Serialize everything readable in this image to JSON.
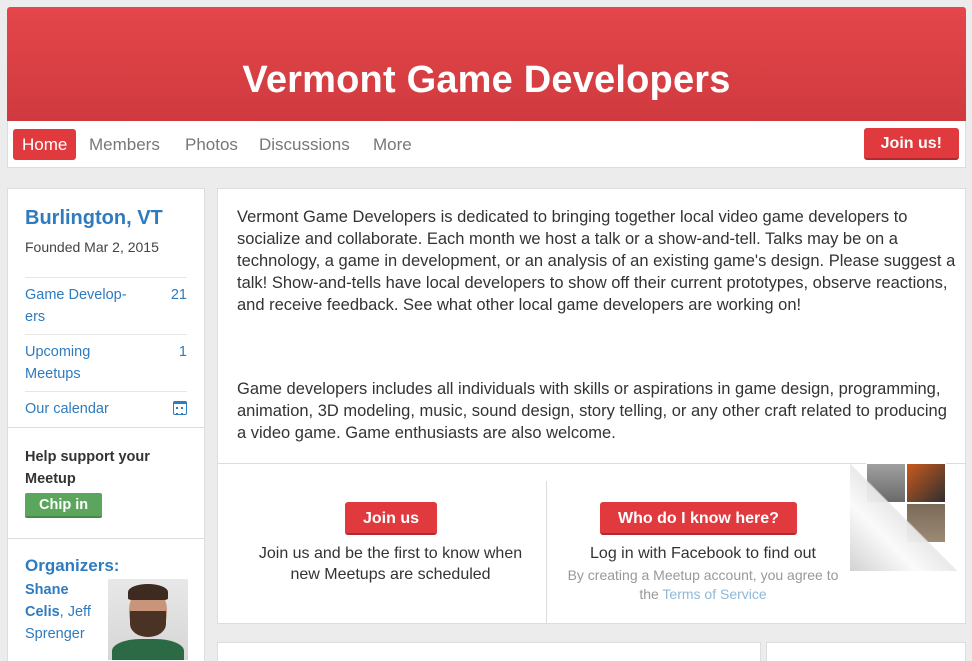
{
  "group": {
    "title": "Vermont Game Developers"
  },
  "nav": {
    "items": [
      "Home",
      "Members",
      "Photos",
      "Discussions",
      "More"
    ],
    "join_label": "Join us!"
  },
  "sidebar": {
    "city": "Burlington, VT",
    "founded": "Founded Mar 2, 2015",
    "rows": [
      {
        "label": "Game Developers",
        "label_display": "Game Develop-ers",
        "count": "21"
      },
      {
        "label": "Upcoming Meetups",
        "count": "1"
      },
      {
        "label": "Our calendar",
        "icon": "calendar-icon"
      }
    ],
    "help_text": "Help support your Meetup",
    "chip_label": "Chip in",
    "organizers_title": "Organizers:",
    "organizer_1": "Shane Celis",
    "organizer_sep": ",",
    "organizer_2": "Jeff Sprenger"
  },
  "main": {
    "description_1": "Vermont Game Developers is dedicated to bringing together local video game developers to socialize and collaborate. Each month we host a talk or a show-and-tell. Talks may be on a technology, a game in development, or an analysis of an existing game's design. Please suggest a talk! Show-and-tells have local developers to show off their current prototypes, observe reactions, and receive feedback. See what other local game developers are working on!",
    "description_2": "Game developers includes all individuals with skills or aspirations in game design, programming, animation, 3D modeling, music, sound design, story telling, or any other craft related to producing a video game. Game enthusiasts are also welcome.",
    "join": {
      "button": "Join us",
      "text": "Join us and be the first to know when new Meetups are scheduled"
    },
    "who": {
      "button": "Who do I know here?",
      "text": "Log in with Facebook to find out",
      "small_prefix": "By creating a Meetup account, you agree to the",
      "terms_link": "Terms of Service"
    }
  },
  "colors": {
    "brand_red": "#e0393e",
    "link_blue": "#2e7bbf",
    "chip_green": "#5ba55c"
  }
}
